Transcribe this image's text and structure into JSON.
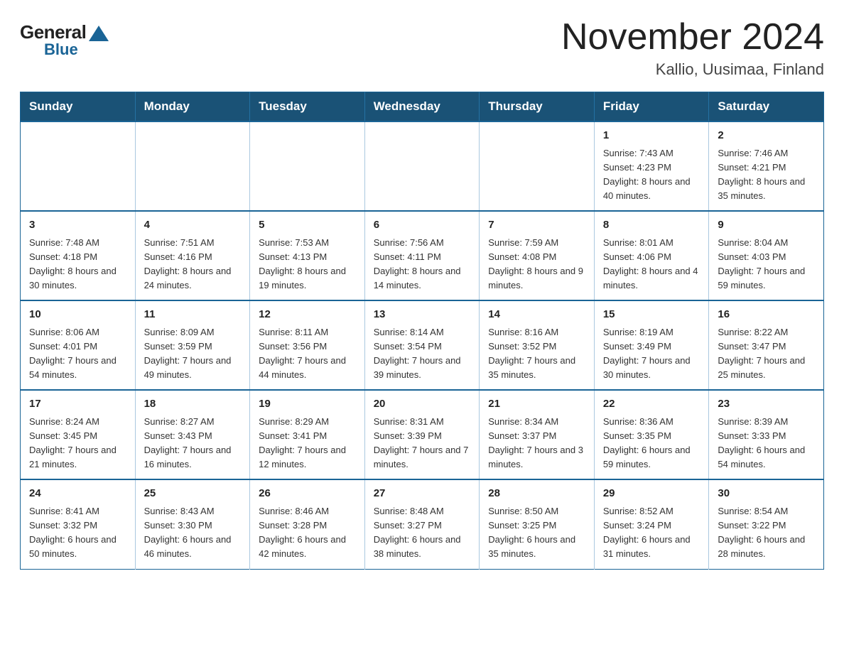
{
  "logo": {
    "general_text": "General",
    "blue_text": "Blue"
  },
  "title": "November 2024",
  "location": "Kallio, Uusimaa, Finland",
  "weekdays": [
    "Sunday",
    "Monday",
    "Tuesday",
    "Wednesday",
    "Thursday",
    "Friday",
    "Saturday"
  ],
  "weeks": [
    [
      {
        "day": "",
        "sunrise": "",
        "sunset": "",
        "daylight": ""
      },
      {
        "day": "",
        "sunrise": "",
        "sunset": "",
        "daylight": ""
      },
      {
        "day": "",
        "sunrise": "",
        "sunset": "",
        "daylight": ""
      },
      {
        "day": "",
        "sunrise": "",
        "sunset": "",
        "daylight": ""
      },
      {
        "day": "",
        "sunrise": "",
        "sunset": "",
        "daylight": ""
      },
      {
        "day": "1",
        "sunrise": "Sunrise: 7:43 AM",
        "sunset": "Sunset: 4:23 PM",
        "daylight": "Daylight: 8 hours and 40 minutes."
      },
      {
        "day": "2",
        "sunrise": "Sunrise: 7:46 AM",
        "sunset": "Sunset: 4:21 PM",
        "daylight": "Daylight: 8 hours and 35 minutes."
      }
    ],
    [
      {
        "day": "3",
        "sunrise": "Sunrise: 7:48 AM",
        "sunset": "Sunset: 4:18 PM",
        "daylight": "Daylight: 8 hours and 30 minutes."
      },
      {
        "day": "4",
        "sunrise": "Sunrise: 7:51 AM",
        "sunset": "Sunset: 4:16 PM",
        "daylight": "Daylight: 8 hours and 24 minutes."
      },
      {
        "day": "5",
        "sunrise": "Sunrise: 7:53 AM",
        "sunset": "Sunset: 4:13 PM",
        "daylight": "Daylight: 8 hours and 19 minutes."
      },
      {
        "day": "6",
        "sunrise": "Sunrise: 7:56 AM",
        "sunset": "Sunset: 4:11 PM",
        "daylight": "Daylight: 8 hours and 14 minutes."
      },
      {
        "day": "7",
        "sunrise": "Sunrise: 7:59 AM",
        "sunset": "Sunset: 4:08 PM",
        "daylight": "Daylight: 8 hours and 9 minutes."
      },
      {
        "day": "8",
        "sunrise": "Sunrise: 8:01 AM",
        "sunset": "Sunset: 4:06 PM",
        "daylight": "Daylight: 8 hours and 4 minutes."
      },
      {
        "day": "9",
        "sunrise": "Sunrise: 8:04 AM",
        "sunset": "Sunset: 4:03 PM",
        "daylight": "Daylight: 7 hours and 59 minutes."
      }
    ],
    [
      {
        "day": "10",
        "sunrise": "Sunrise: 8:06 AM",
        "sunset": "Sunset: 4:01 PM",
        "daylight": "Daylight: 7 hours and 54 minutes."
      },
      {
        "day": "11",
        "sunrise": "Sunrise: 8:09 AM",
        "sunset": "Sunset: 3:59 PM",
        "daylight": "Daylight: 7 hours and 49 minutes."
      },
      {
        "day": "12",
        "sunrise": "Sunrise: 8:11 AM",
        "sunset": "Sunset: 3:56 PM",
        "daylight": "Daylight: 7 hours and 44 minutes."
      },
      {
        "day": "13",
        "sunrise": "Sunrise: 8:14 AM",
        "sunset": "Sunset: 3:54 PM",
        "daylight": "Daylight: 7 hours and 39 minutes."
      },
      {
        "day": "14",
        "sunrise": "Sunrise: 8:16 AM",
        "sunset": "Sunset: 3:52 PM",
        "daylight": "Daylight: 7 hours and 35 minutes."
      },
      {
        "day": "15",
        "sunrise": "Sunrise: 8:19 AM",
        "sunset": "Sunset: 3:49 PM",
        "daylight": "Daylight: 7 hours and 30 minutes."
      },
      {
        "day": "16",
        "sunrise": "Sunrise: 8:22 AM",
        "sunset": "Sunset: 3:47 PM",
        "daylight": "Daylight: 7 hours and 25 minutes."
      }
    ],
    [
      {
        "day": "17",
        "sunrise": "Sunrise: 8:24 AM",
        "sunset": "Sunset: 3:45 PM",
        "daylight": "Daylight: 7 hours and 21 minutes."
      },
      {
        "day": "18",
        "sunrise": "Sunrise: 8:27 AM",
        "sunset": "Sunset: 3:43 PM",
        "daylight": "Daylight: 7 hours and 16 minutes."
      },
      {
        "day": "19",
        "sunrise": "Sunrise: 8:29 AM",
        "sunset": "Sunset: 3:41 PM",
        "daylight": "Daylight: 7 hours and 12 minutes."
      },
      {
        "day": "20",
        "sunrise": "Sunrise: 8:31 AM",
        "sunset": "Sunset: 3:39 PM",
        "daylight": "Daylight: 7 hours and 7 minutes."
      },
      {
        "day": "21",
        "sunrise": "Sunrise: 8:34 AM",
        "sunset": "Sunset: 3:37 PM",
        "daylight": "Daylight: 7 hours and 3 minutes."
      },
      {
        "day": "22",
        "sunrise": "Sunrise: 8:36 AM",
        "sunset": "Sunset: 3:35 PM",
        "daylight": "Daylight: 6 hours and 59 minutes."
      },
      {
        "day": "23",
        "sunrise": "Sunrise: 8:39 AM",
        "sunset": "Sunset: 3:33 PM",
        "daylight": "Daylight: 6 hours and 54 minutes."
      }
    ],
    [
      {
        "day": "24",
        "sunrise": "Sunrise: 8:41 AM",
        "sunset": "Sunset: 3:32 PM",
        "daylight": "Daylight: 6 hours and 50 minutes."
      },
      {
        "day": "25",
        "sunrise": "Sunrise: 8:43 AM",
        "sunset": "Sunset: 3:30 PM",
        "daylight": "Daylight: 6 hours and 46 minutes."
      },
      {
        "day": "26",
        "sunrise": "Sunrise: 8:46 AM",
        "sunset": "Sunset: 3:28 PM",
        "daylight": "Daylight: 6 hours and 42 minutes."
      },
      {
        "day": "27",
        "sunrise": "Sunrise: 8:48 AM",
        "sunset": "Sunset: 3:27 PM",
        "daylight": "Daylight: 6 hours and 38 minutes."
      },
      {
        "day": "28",
        "sunrise": "Sunrise: 8:50 AM",
        "sunset": "Sunset: 3:25 PM",
        "daylight": "Daylight: 6 hours and 35 minutes."
      },
      {
        "day": "29",
        "sunrise": "Sunrise: 8:52 AM",
        "sunset": "Sunset: 3:24 PM",
        "daylight": "Daylight: 6 hours and 31 minutes."
      },
      {
        "day": "30",
        "sunrise": "Sunrise: 8:54 AM",
        "sunset": "Sunset: 3:22 PM",
        "daylight": "Daylight: 6 hours and 28 minutes."
      }
    ]
  ]
}
